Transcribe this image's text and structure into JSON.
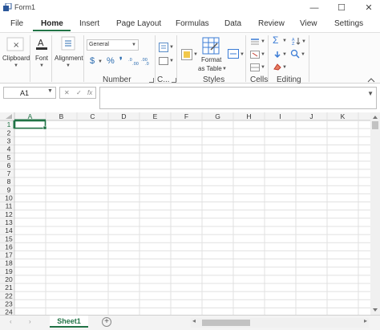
{
  "window": {
    "title": "Form1",
    "minimize": "—",
    "maximize": "☐",
    "close": "✕"
  },
  "tabs": [
    "File",
    "Home",
    "Insert",
    "Page Layout",
    "Formulas",
    "Data",
    "Review",
    "View",
    "Settings"
  ],
  "active_tab": "Home",
  "ribbon": {
    "clipboard": {
      "label": "Clipboard"
    },
    "font": {
      "label": "Font"
    },
    "alignment": {
      "label": "Alignment"
    },
    "number": {
      "label": "Number",
      "format_value": "General",
      "currency": "$",
      "percent": "%",
      "comma": "❜"
    },
    "styles": {
      "label": "Styles",
      "format_as_table_line1": "Format",
      "format_as_table_line2": "as Table"
    },
    "conditional": {
      "label": "C..."
    },
    "cells": {
      "label": "Cells"
    },
    "editing": {
      "label": "Editing",
      "sum_icon": "Σ"
    }
  },
  "formula_bar": {
    "name_box": "A1",
    "fx": "fx",
    "cancel": "✕",
    "enter": "✓",
    "value": ""
  },
  "grid": {
    "columns": [
      "A",
      "B",
      "C",
      "D",
      "E",
      "F",
      "G",
      "H",
      "I",
      "J",
      "K"
    ],
    "rows": [
      "1",
      "2",
      "3",
      "4",
      "5",
      "6",
      "7",
      "8",
      "9",
      "10",
      "11",
      "12",
      "13",
      "14",
      "15",
      "16",
      "17",
      "18",
      "19",
      "20",
      "21",
      "22",
      "23",
      "24"
    ],
    "selected_cell": "A1"
  },
  "sheets": {
    "tabs": [
      "Sheet1"
    ],
    "add": "+"
  },
  "colors": {
    "accent": "#217346",
    "header_bg": "#f3f3f3",
    "gridline": "#e1e1e1"
  }
}
